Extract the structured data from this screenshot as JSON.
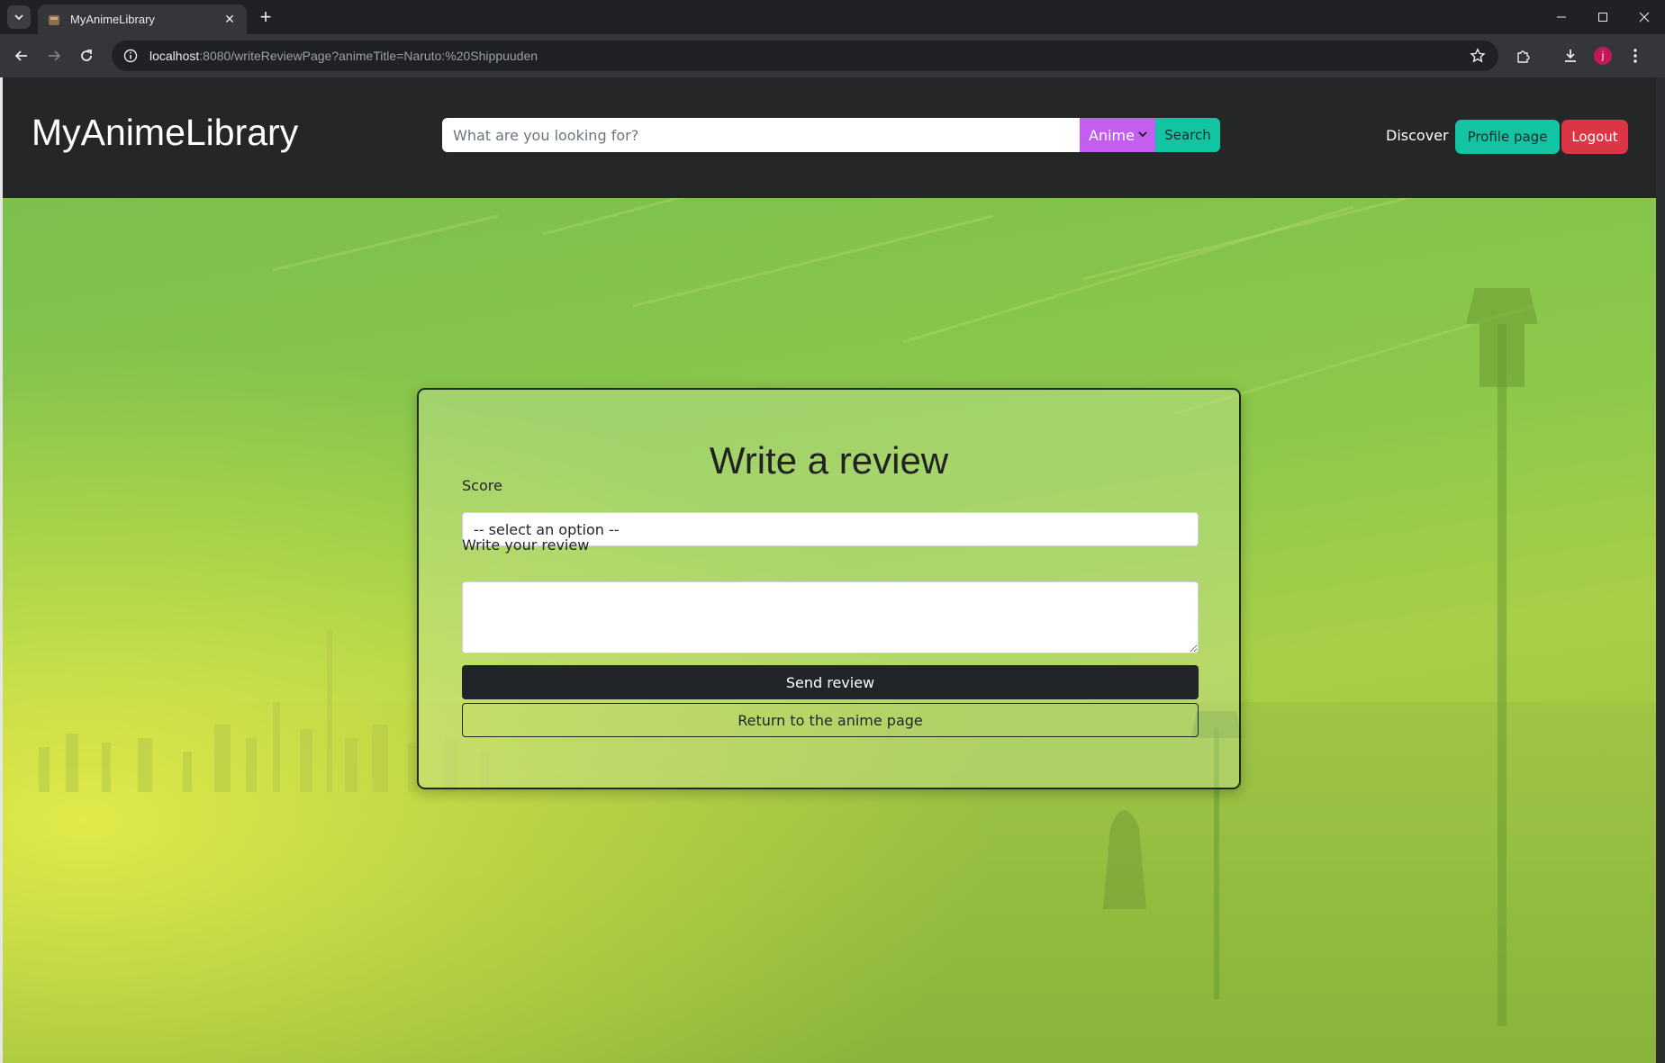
{
  "browser": {
    "tab_title": "MyAnimeLibrary",
    "url_host": "localhost",
    "url_rest": ":8080/writeReviewPage?animeTitle=Naruto:%20Shippuuden",
    "profile_initial": "j"
  },
  "navbar": {
    "brand": "MyAnimeLibrary",
    "search_placeholder": "What are you looking for?",
    "search_type": "Anime",
    "search_button": "Search",
    "discover": "Discover",
    "profile_button": "Profile page",
    "logout_button": "Logout"
  },
  "form": {
    "title": "Write a review",
    "score_label": "Score",
    "score_selected": "-- select an option --",
    "review_label": "Write your review",
    "send_button": "Send review",
    "return_button": "Return to the anime page"
  },
  "colors": {
    "accent_teal": "#13c4a3",
    "accent_purple": "#c55ef0",
    "danger_red": "#dc3545",
    "navbar_bg": "#252628"
  }
}
